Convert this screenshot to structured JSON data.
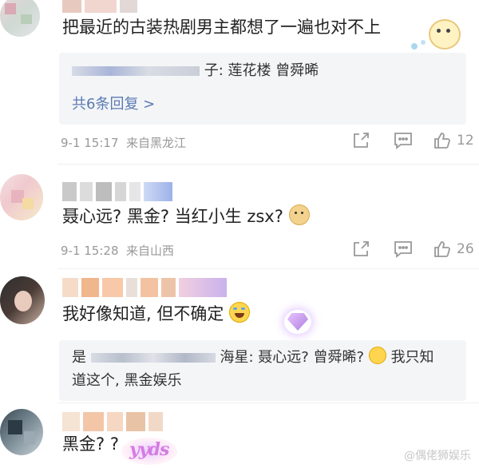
{
  "comments": [
    {
      "text": "把最近的古装热剧男主都想了一遍也对不上",
      "reply": {
        "suffix": "子: 莲花楼 曾舜晞",
        "more_label": "共6条回复 >"
      },
      "time": "9-1 15:17",
      "location": "来自黑龙江",
      "likes": "12"
    },
    {
      "text": "聂心远? 黑金? 当红小生 zsx?",
      "time": "9-1 15:28",
      "location": "来自山西",
      "likes": "26"
    },
    {
      "text": "我好像知道, 但不确定",
      "reply": {
        "prefix": "是",
        "suffix": "海星: 聂心远? 曾舜晞?",
        "suffix2": "我只知",
        "line2": "道这个, 黑金娱乐"
      }
    },
    {
      "text": "黑金? ?",
      "sticker": "yyds"
    }
  ],
  "watermark": "@偶佬狮娱乐",
  "colors": {
    "link": "#5a7ab3",
    "meta": "#999999",
    "reply_bg": "#f4f5f7"
  }
}
